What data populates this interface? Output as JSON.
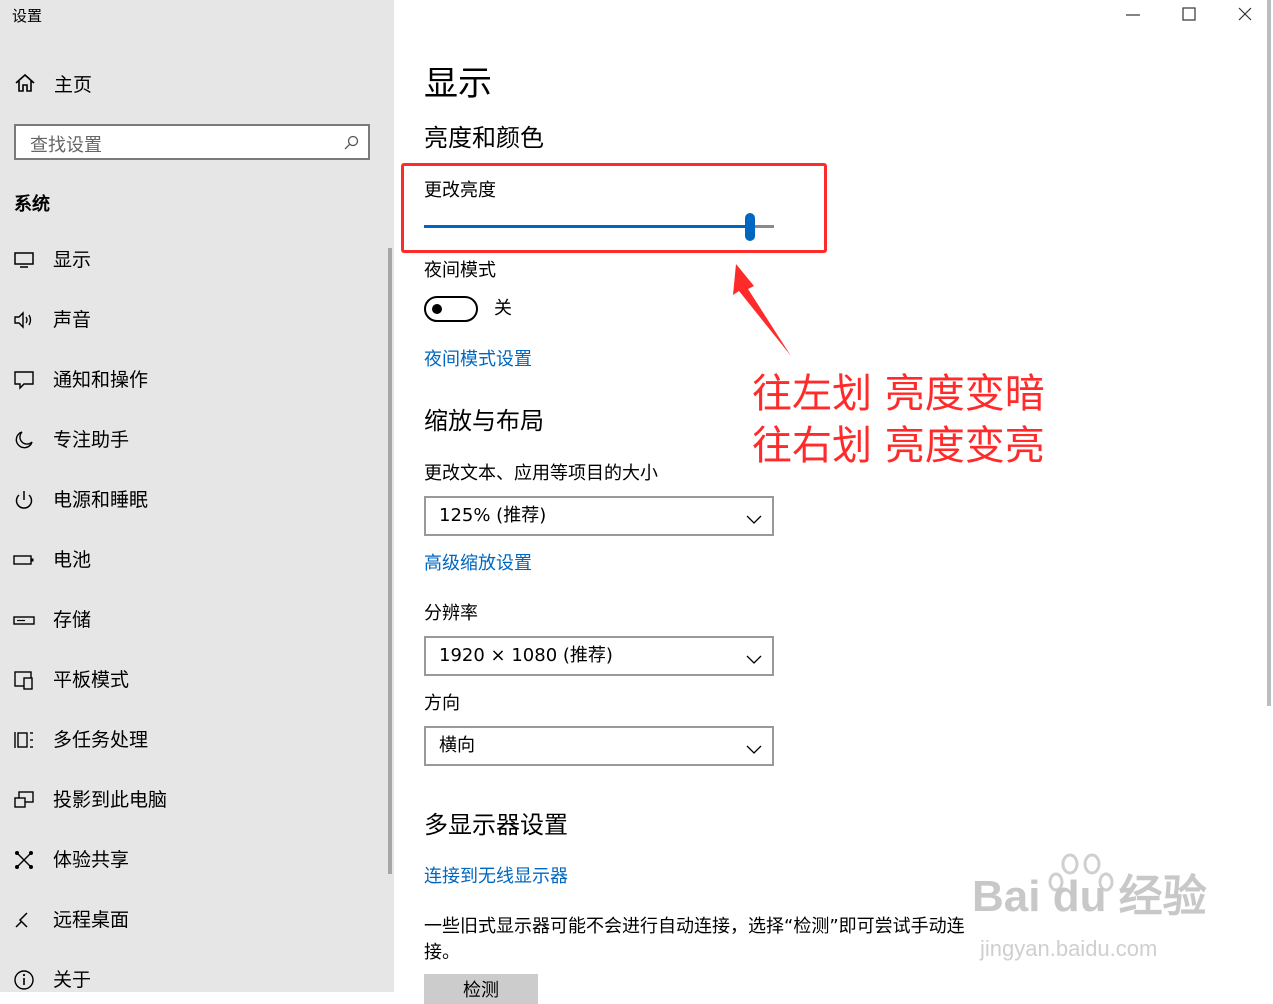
{
  "app": {
    "title": "设置"
  },
  "sidebar": {
    "home_label": "主页",
    "search_placeholder": "查找设置",
    "section_title": "系统",
    "items": [
      {
        "label": "显示",
        "icon": "monitor-icon"
      },
      {
        "label": "声音",
        "icon": "speaker-icon"
      },
      {
        "label": "通知和操作",
        "icon": "notification-icon"
      },
      {
        "label": "专注助手",
        "icon": "moon-icon"
      },
      {
        "label": "电源和睡眠",
        "icon": "power-icon"
      },
      {
        "label": "电池",
        "icon": "battery-icon"
      },
      {
        "label": "存储",
        "icon": "storage-icon"
      },
      {
        "label": "平板模式",
        "icon": "tablet-mode-icon"
      },
      {
        "label": "多任务处理",
        "icon": "multitasking-icon"
      },
      {
        "label": "投影到此电脑",
        "icon": "project-icon"
      },
      {
        "label": "体验共享",
        "icon": "shared-experience-icon"
      },
      {
        "label": "远程桌面",
        "icon": "remote-desktop-icon"
      },
      {
        "label": "关于",
        "icon": "info-icon"
      }
    ]
  },
  "main": {
    "page_title": "显示",
    "brightness_section": "亮度和颜色",
    "brightness_label": "更改亮度",
    "brightness_value": 0.93,
    "night_mode_label": "夜间模式",
    "night_mode_state": "关",
    "night_mode_link": "夜间模式设置",
    "scale_section": "缩放与布局",
    "scale_label": "更改文本、应用等项目的大小",
    "scale_value": "125% (推荐)",
    "advanced_scale_link": "高级缩放设置",
    "resolution_label": "分辨率",
    "resolution_value": "1920 × 1080 (推荐)",
    "orientation_label": "方向",
    "orientation_value": "横向",
    "multi_display_section": "多显示器设置",
    "wireless_link": "连接到无线显示器",
    "legacy_text": "一些旧式显示器可能不会进行自动连接，选择“检测”即可尝试手动连接。",
    "detect_button": "检测"
  },
  "annotation": {
    "line1": "往左划 亮度变暗",
    "line2": "往右划 亮度变亮",
    "color": "#ff2a2a"
  },
  "watermark": {
    "brand": "Bai du 经验",
    "url": "jingyan.baidu.com"
  },
  "colors": {
    "accent": "#0067c0",
    "sidebar_bg": "#e6e6e6"
  }
}
